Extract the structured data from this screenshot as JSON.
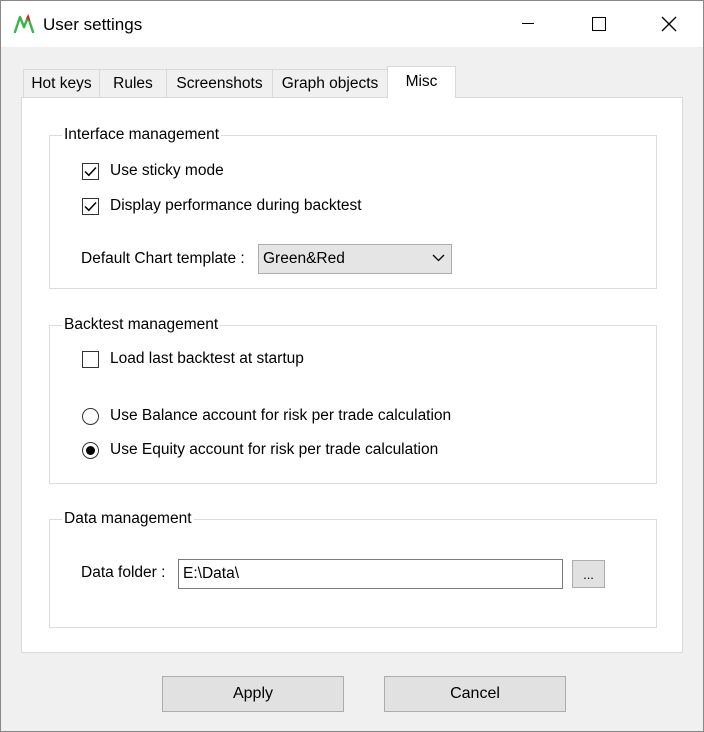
{
  "window": {
    "title": "User settings",
    "icons": {
      "app": "app-logo-icon",
      "minimize": "minimize-icon",
      "maximize": "maximize-icon",
      "close": "close-icon"
    }
  },
  "tabs": [
    {
      "label": "Hot keys",
      "active": false
    },
    {
      "label": "Rules",
      "active": false
    },
    {
      "label": "Screenshots",
      "active": false
    },
    {
      "label": "Graph objects",
      "active": false
    },
    {
      "label": "Misc",
      "active": true
    }
  ],
  "interface": {
    "title": "Interface management",
    "sticky_mode": {
      "label": "Use sticky mode",
      "checked": true
    },
    "display_performance": {
      "label": "Display performance during backtest",
      "checked": true
    },
    "chart_template_label": "Default Chart template :",
    "chart_template_value": "Green&Red"
  },
  "backtest": {
    "title": "Backtest management",
    "load_last": {
      "label": "Load last backtest at startup",
      "checked": false
    },
    "radio_balance": {
      "label": "Use Balance account for risk per trade calculation",
      "selected": false
    },
    "radio_equity": {
      "label": "Use Equity account for risk per trade calculation",
      "selected": true
    }
  },
  "data": {
    "title": "Data management",
    "folder_label": "Data folder :",
    "folder_value": "E:\\Data\\",
    "browse_label": "..."
  },
  "buttons": {
    "apply": "Apply",
    "cancel": "Cancel"
  },
  "colors": {
    "logo_green": "#3bb54a",
    "logo_red": "#e0242b"
  }
}
